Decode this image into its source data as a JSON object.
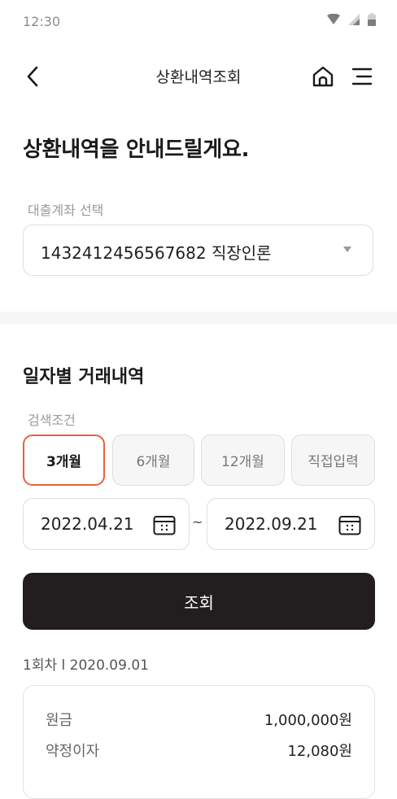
{
  "status_bar": {
    "time": "12:30"
  },
  "header": {
    "title": "상환내역조회"
  },
  "headline": "상환내역을 안내드릴게요.",
  "account": {
    "label": "대출계좌 선택",
    "selected": "1432412456567682 직장인론"
  },
  "history": {
    "title": "일자별 거래내역",
    "search_label": "검색조건",
    "periods": [
      "3개월",
      "6개월",
      "12개월",
      "직접입력"
    ],
    "active_period": "3개월",
    "start_date": "2022.04.21",
    "date_separator": "~",
    "end_date": "2022.09.21",
    "search_button": "조회"
  },
  "result": {
    "round_info": "1회차 l 2020.09.01",
    "rows": [
      {
        "label": "원금",
        "value": "1,000,000원"
      },
      {
        "label": "약정이자",
        "value": "12,080원"
      }
    ]
  },
  "colors": {
    "accent": "#e8623a",
    "primary_button": "#221e1f"
  }
}
